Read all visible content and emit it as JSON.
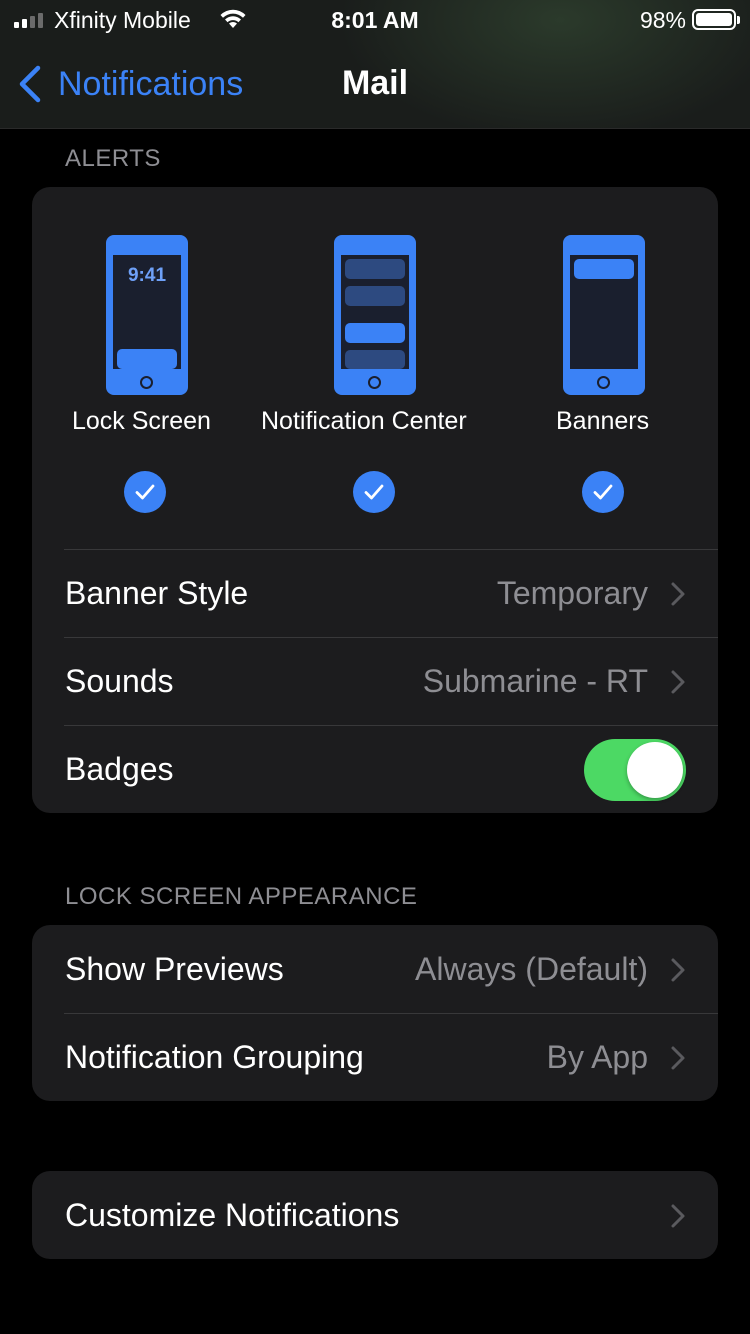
{
  "status_bar": {
    "carrier": "Xfinity Mobile",
    "time": "8:01 AM",
    "battery_percent": "98%",
    "signal_bars_filled": 2,
    "signal_bars_total": 4,
    "battery_level": 0.98
  },
  "nav": {
    "back_label": "Notifications",
    "title": "Mail"
  },
  "alerts": {
    "header": "ALERTS",
    "items": [
      {
        "label": "Lock Screen",
        "checked": true,
        "preview_time": "9:41"
      },
      {
        "label": "Notification Center",
        "checked": true
      },
      {
        "label": "Banners",
        "checked": true
      }
    ],
    "rows": [
      {
        "label": "Banner Style",
        "value": "Temporary"
      },
      {
        "label": "Sounds",
        "value": "Submarine - RT"
      },
      {
        "label": "Badges",
        "toggle_on": true
      }
    ]
  },
  "lock_screen_appearance": {
    "header": "LOCK SCREEN APPEARANCE",
    "rows": [
      {
        "label": "Show Previews",
        "value": "Always (Default)"
      },
      {
        "label": "Notification Grouping",
        "value": "By App"
      }
    ]
  },
  "customize": {
    "label": "Customize Notifications"
  },
  "colors": {
    "accent": "#3b82f6",
    "toggle_on": "#4cd964",
    "background": "#000000",
    "card": "#1c1c1e",
    "secondary_text": "#8e8e93"
  }
}
